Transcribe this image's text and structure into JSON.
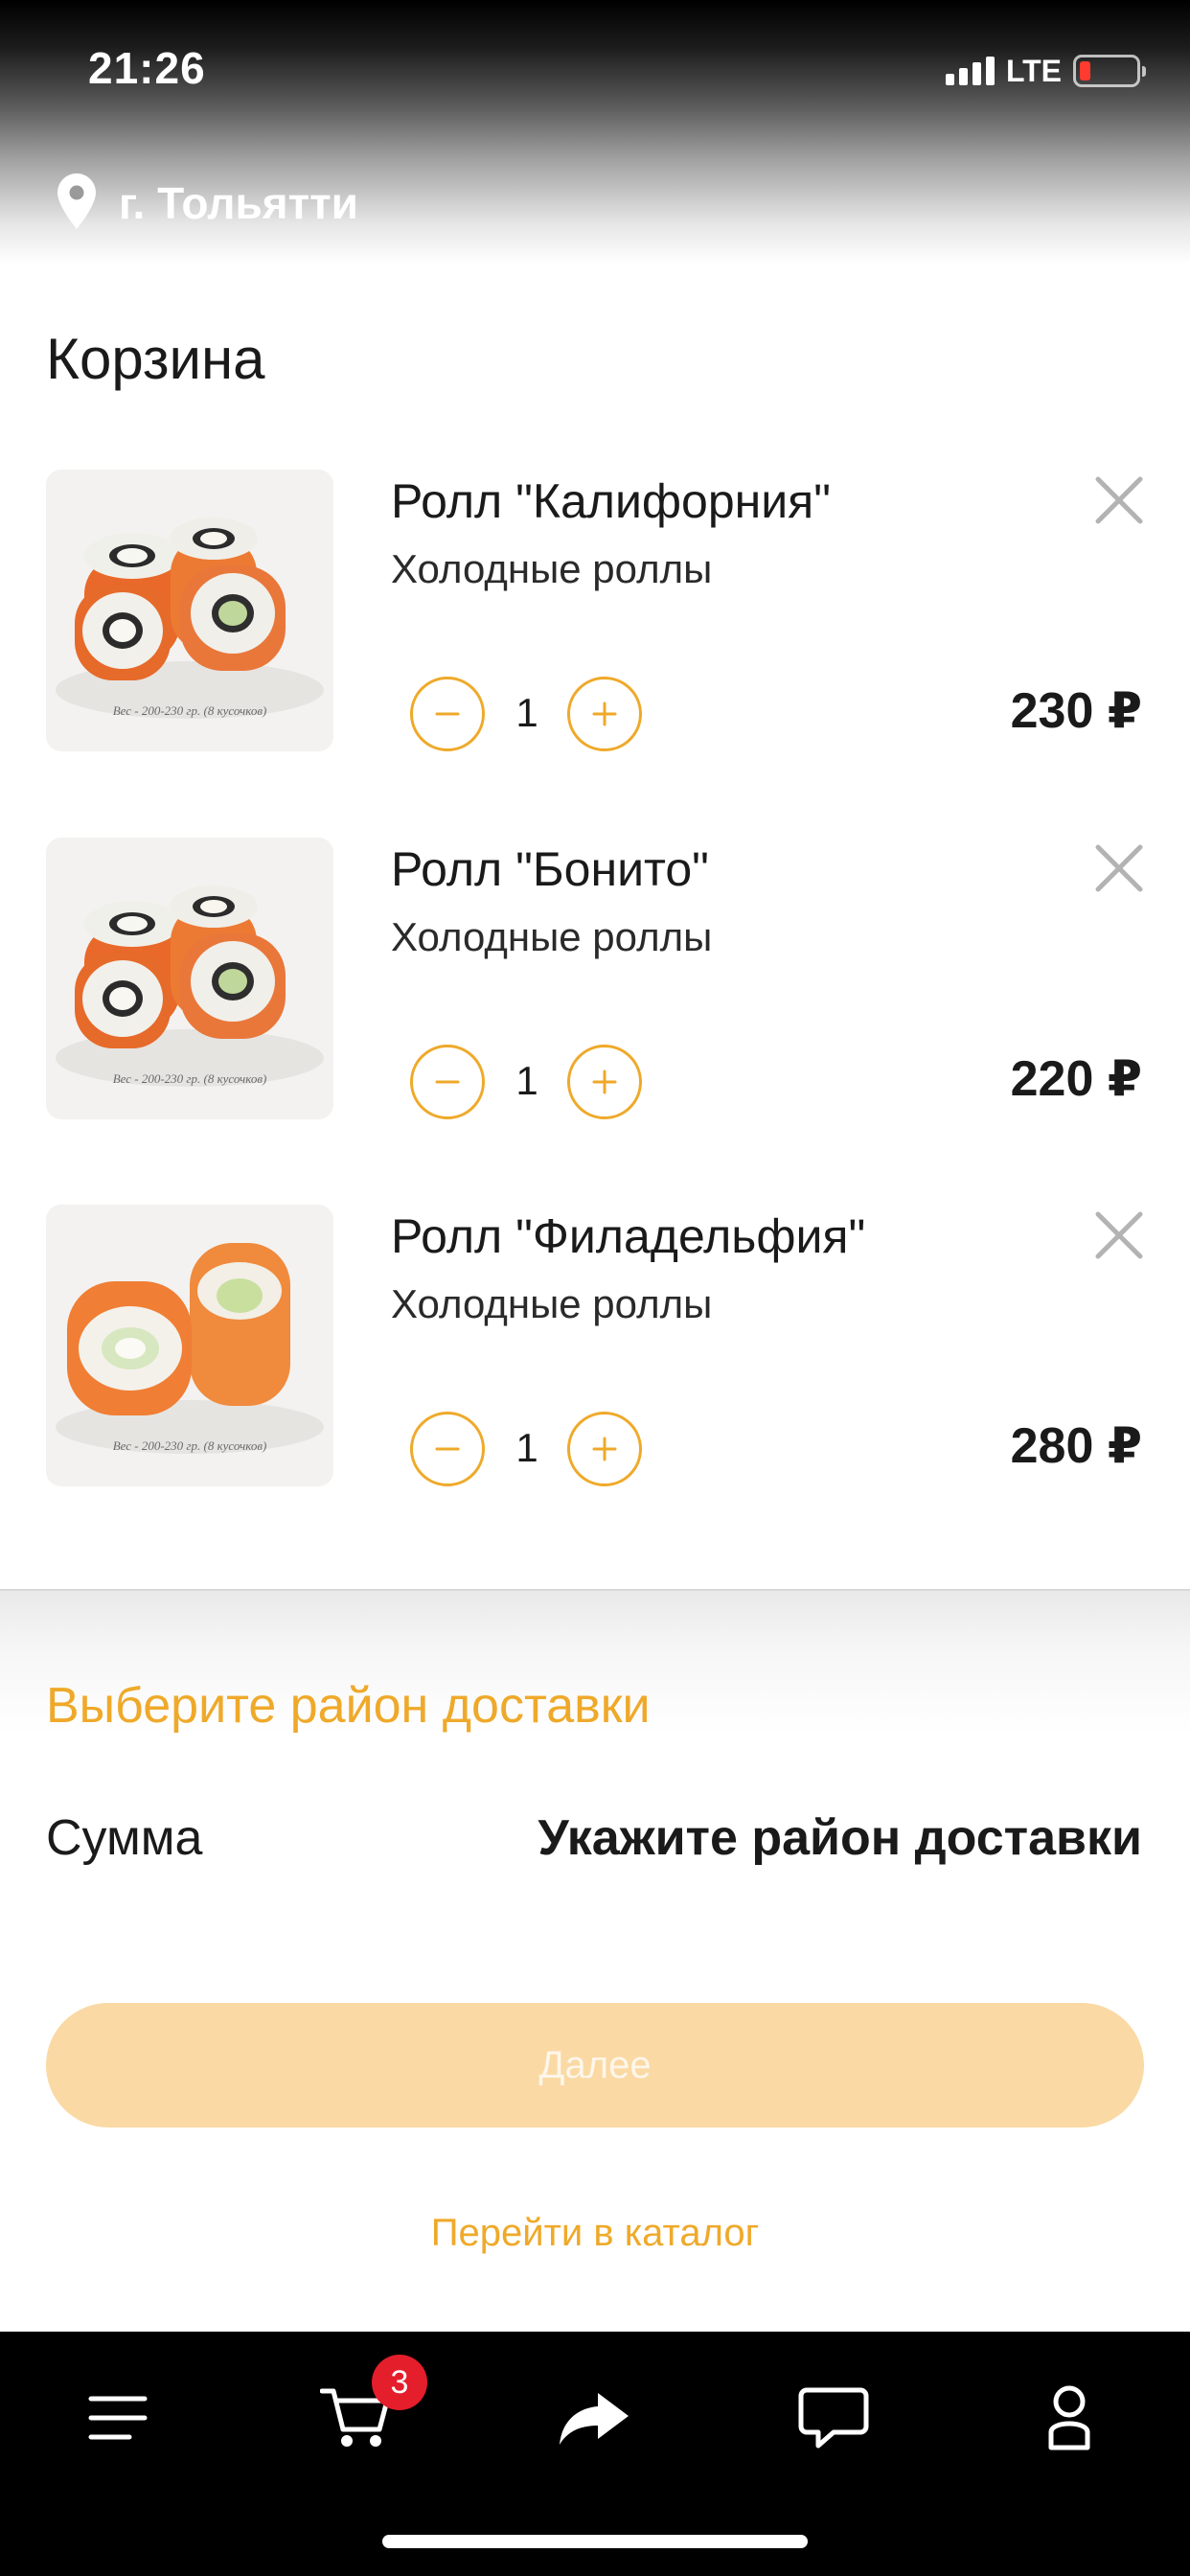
{
  "status_bar": {
    "time": "21:26",
    "network": "LTE",
    "battery_level": 0.12,
    "battery_color": "#ff3b30"
  },
  "header": {
    "city": "г. Тольятти",
    "icon": "location-pin-icon"
  },
  "cart": {
    "title": "Корзина",
    "items": [
      {
        "name": "Ролл \"Калифорния\"",
        "category": "Холодные роллы",
        "quantity": "1",
        "price": "230 ₽",
        "image_caption": "Вес - 200-230 гр. (8 кусочков)"
      },
      {
        "name": "Ролл \"Бонито\"",
        "category": "Холодные роллы",
        "quantity": "1",
        "price": "220 ₽",
        "image_caption": "Вес - 200-230 гр. (8 кусочков)"
      },
      {
        "name": "Ролл \"Филадельфия\"",
        "category": "Холодные роллы",
        "quantity": "1",
        "price": "280 ₽",
        "image_caption": "Вес - 200-230 гр. (8 кусочков)"
      }
    ]
  },
  "summary": {
    "delivery_link": "Выберите район доставки",
    "sum_label": "Сумма",
    "sum_value": "Укажите район доставки",
    "next_button": "Далее",
    "catalog_link": "Перейти в каталог"
  },
  "tab_bar": {
    "items": [
      "menu-icon",
      "cart-icon",
      "share-icon",
      "chat-icon",
      "profile-icon"
    ],
    "cart_badge": "3"
  },
  "colors": {
    "accent": "#efa92a",
    "button_disabled": "#fad9a4",
    "badge": "#e41e2b",
    "tab_bar_bg": "#000000"
  }
}
